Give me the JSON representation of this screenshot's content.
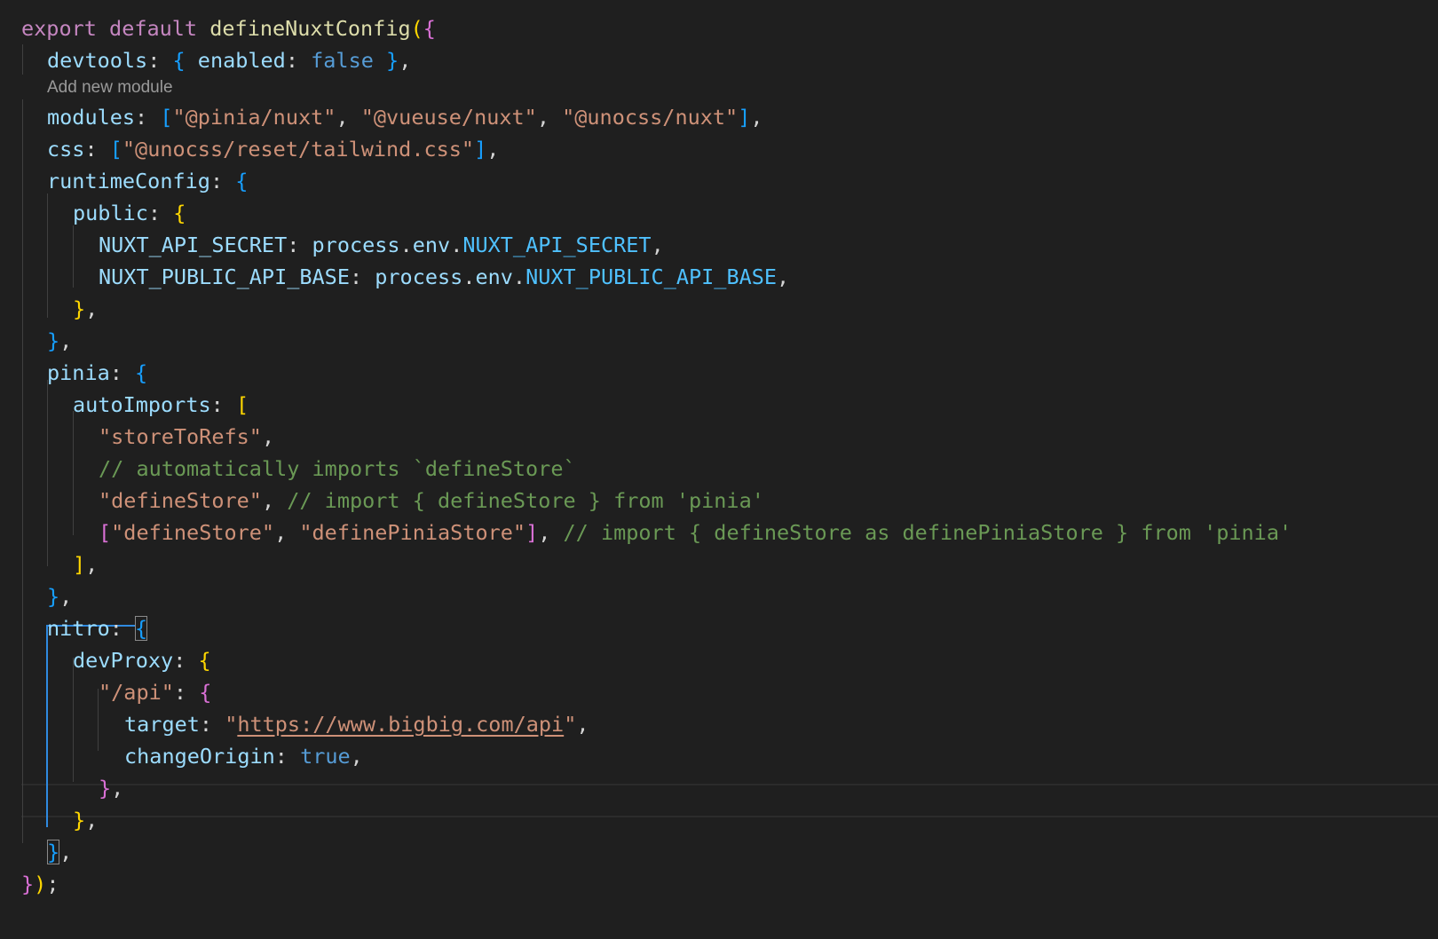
{
  "editor": {
    "code_lens": "Add new module",
    "lines": [
      [
        [
          "kw",
          "export"
        ],
        [
          "pn",
          " "
        ],
        [
          "kw",
          "default"
        ],
        [
          "pn",
          " "
        ],
        [
          "fn",
          "defineNuxtConfig"
        ],
        [
          "b1",
          "("
        ],
        [
          "b2",
          "{"
        ]
      ],
      [
        [
          "ind",
          ""
        ],
        [
          "prop",
          "devtools"
        ],
        [
          "pn",
          ": "
        ],
        [
          "b3",
          "{"
        ],
        [
          "pn",
          " "
        ],
        [
          "prop",
          "enabled"
        ],
        [
          "pn",
          ": "
        ],
        [
          "bool",
          "false"
        ],
        [
          "pn",
          " "
        ],
        [
          "b3",
          "}"
        ],
        [
          "pn",
          ","
        ]
      ],
      [
        [
          "ind",
          ""
        ],
        [
          "prop",
          "modules"
        ],
        [
          "pn",
          ": "
        ],
        [
          "b3",
          "["
        ],
        [
          "str",
          "\"@pinia/nuxt\""
        ],
        [
          "pn",
          ", "
        ],
        [
          "str",
          "\"@vueuse/nuxt\""
        ],
        [
          "pn",
          ", "
        ],
        [
          "str",
          "\"@unocss/nuxt\""
        ],
        [
          "b3",
          "]"
        ],
        [
          "pn",
          ","
        ]
      ],
      [
        [
          "ind",
          ""
        ],
        [
          "prop",
          "css"
        ],
        [
          "pn",
          ": "
        ],
        [
          "b3",
          "["
        ],
        [
          "str",
          "\"@unocss/reset/tailwind.css\""
        ],
        [
          "b3",
          "]"
        ],
        [
          "pn",
          ","
        ]
      ],
      [
        [
          "ind",
          ""
        ],
        [
          "prop",
          "runtimeConfig"
        ],
        [
          "pn",
          ": "
        ],
        [
          "b3",
          "{"
        ]
      ],
      [
        [
          "ind",
          ""
        ],
        [
          "ind",
          ""
        ],
        [
          "prop",
          "public"
        ],
        [
          "pn",
          ": "
        ],
        [
          "b1",
          "{"
        ]
      ],
      [
        [
          "ind",
          ""
        ],
        [
          "ind",
          ""
        ],
        [
          "ind",
          ""
        ],
        [
          "prop",
          "NUXT_API_SECRET"
        ],
        [
          "pn",
          ": "
        ],
        [
          "prop",
          "process"
        ],
        [
          "pn",
          "."
        ],
        [
          "prop",
          "env"
        ],
        [
          "pn",
          "."
        ],
        [
          "const",
          "NUXT_API_SECRET"
        ],
        [
          "pn",
          ","
        ]
      ],
      [
        [
          "ind",
          ""
        ],
        [
          "ind",
          ""
        ],
        [
          "ind",
          ""
        ],
        [
          "prop",
          "NUXT_PUBLIC_API_BASE"
        ],
        [
          "pn",
          ": "
        ],
        [
          "prop",
          "process"
        ],
        [
          "pn",
          "."
        ],
        [
          "prop",
          "env"
        ],
        [
          "pn",
          "."
        ],
        [
          "const",
          "NUXT_PUBLIC_API_BASE"
        ],
        [
          "pn",
          ","
        ]
      ],
      [
        [
          "ind",
          ""
        ],
        [
          "ind",
          ""
        ],
        [
          "b1",
          "}"
        ],
        [
          "pn",
          ","
        ]
      ],
      [
        [
          "ind",
          ""
        ],
        [
          "b3",
          "}"
        ],
        [
          "pn",
          ","
        ]
      ],
      [
        [
          "ind",
          ""
        ],
        [
          "prop",
          "pinia"
        ],
        [
          "pn",
          ": "
        ],
        [
          "b3",
          "{"
        ]
      ],
      [
        [
          "ind",
          ""
        ],
        [
          "ind",
          ""
        ],
        [
          "prop",
          "autoImports"
        ],
        [
          "pn",
          ": "
        ],
        [
          "b1",
          "["
        ]
      ],
      [
        [
          "ind",
          ""
        ],
        [
          "ind",
          ""
        ],
        [
          "ind",
          ""
        ],
        [
          "str",
          "\"storeToRefs\""
        ],
        [
          "pn",
          ","
        ]
      ],
      [
        [
          "ind",
          ""
        ],
        [
          "ind",
          ""
        ],
        [
          "ind",
          ""
        ],
        [
          "cm",
          "// automatically imports `defineStore`"
        ]
      ],
      [
        [
          "ind",
          ""
        ],
        [
          "ind",
          ""
        ],
        [
          "ind",
          ""
        ],
        [
          "str",
          "\"defineStore\""
        ],
        [
          "pn",
          ", "
        ],
        [
          "cm",
          "// import { defineStore } from 'pinia'"
        ]
      ],
      [
        [
          "ind",
          ""
        ],
        [
          "ind",
          ""
        ],
        [
          "ind",
          ""
        ],
        [
          "b2",
          "["
        ],
        [
          "str",
          "\"defineStore\""
        ],
        [
          "pn",
          ", "
        ],
        [
          "str",
          "\"definePiniaStore\""
        ],
        [
          "b2",
          "]"
        ],
        [
          "pn",
          ", "
        ],
        [
          "cm",
          "// import { defineStore as definePiniaStore } from 'pinia'"
        ]
      ],
      [
        [
          "ind",
          ""
        ],
        [
          "ind",
          ""
        ],
        [
          "b1",
          "]"
        ],
        [
          "pn",
          ","
        ]
      ],
      [
        [
          "ind",
          ""
        ],
        [
          "b3",
          "}"
        ],
        [
          "pn",
          ","
        ]
      ],
      [
        [
          "ind",
          ""
        ],
        [
          "prop",
          "nitro"
        ],
        [
          "pn",
          ": "
        ],
        [
          "b3m",
          "{"
        ]
      ],
      [
        [
          "ind",
          ""
        ],
        [
          "ind",
          ""
        ],
        [
          "prop",
          "devProxy"
        ],
        [
          "pn",
          ": "
        ],
        [
          "b1",
          "{"
        ]
      ],
      [
        [
          "ind",
          ""
        ],
        [
          "ind",
          ""
        ],
        [
          "ind",
          ""
        ],
        [
          "str",
          "\"/api\""
        ],
        [
          "pn",
          ": "
        ],
        [
          "b2",
          "{"
        ]
      ],
      [
        [
          "ind",
          ""
        ],
        [
          "ind",
          ""
        ],
        [
          "ind",
          ""
        ],
        [
          "ind",
          ""
        ],
        [
          "prop",
          "target"
        ],
        [
          "pn",
          ": "
        ],
        [
          "str",
          "\""
        ],
        [
          "link",
          "https://www.bigbig.com/api"
        ],
        [
          "str",
          "\""
        ],
        [
          "pn",
          ","
        ]
      ],
      [
        [
          "ind",
          ""
        ],
        [
          "ind",
          ""
        ],
        [
          "ind",
          ""
        ],
        [
          "ind",
          ""
        ],
        [
          "prop",
          "changeOrigin"
        ],
        [
          "pn",
          ": "
        ],
        [
          "bool",
          "true"
        ],
        [
          "pn",
          ","
        ]
      ],
      [
        [
          "ind",
          ""
        ],
        [
          "ind",
          ""
        ],
        [
          "ind",
          ""
        ],
        [
          "b2",
          "}"
        ],
        [
          "pn",
          ","
        ]
      ],
      [
        [
          "ind",
          ""
        ],
        [
          "ind",
          ""
        ],
        [
          "b1",
          "}"
        ],
        [
          "pn",
          ","
        ]
      ],
      [
        [
          "ind",
          ""
        ],
        [
          "b3m",
          "}"
        ],
        [
          "pn",
          ","
        ]
      ],
      [
        [
          "b2",
          "}"
        ],
        [
          "b1",
          ")"
        ],
        [
          "pn",
          ";"
        ]
      ]
    ]
  }
}
